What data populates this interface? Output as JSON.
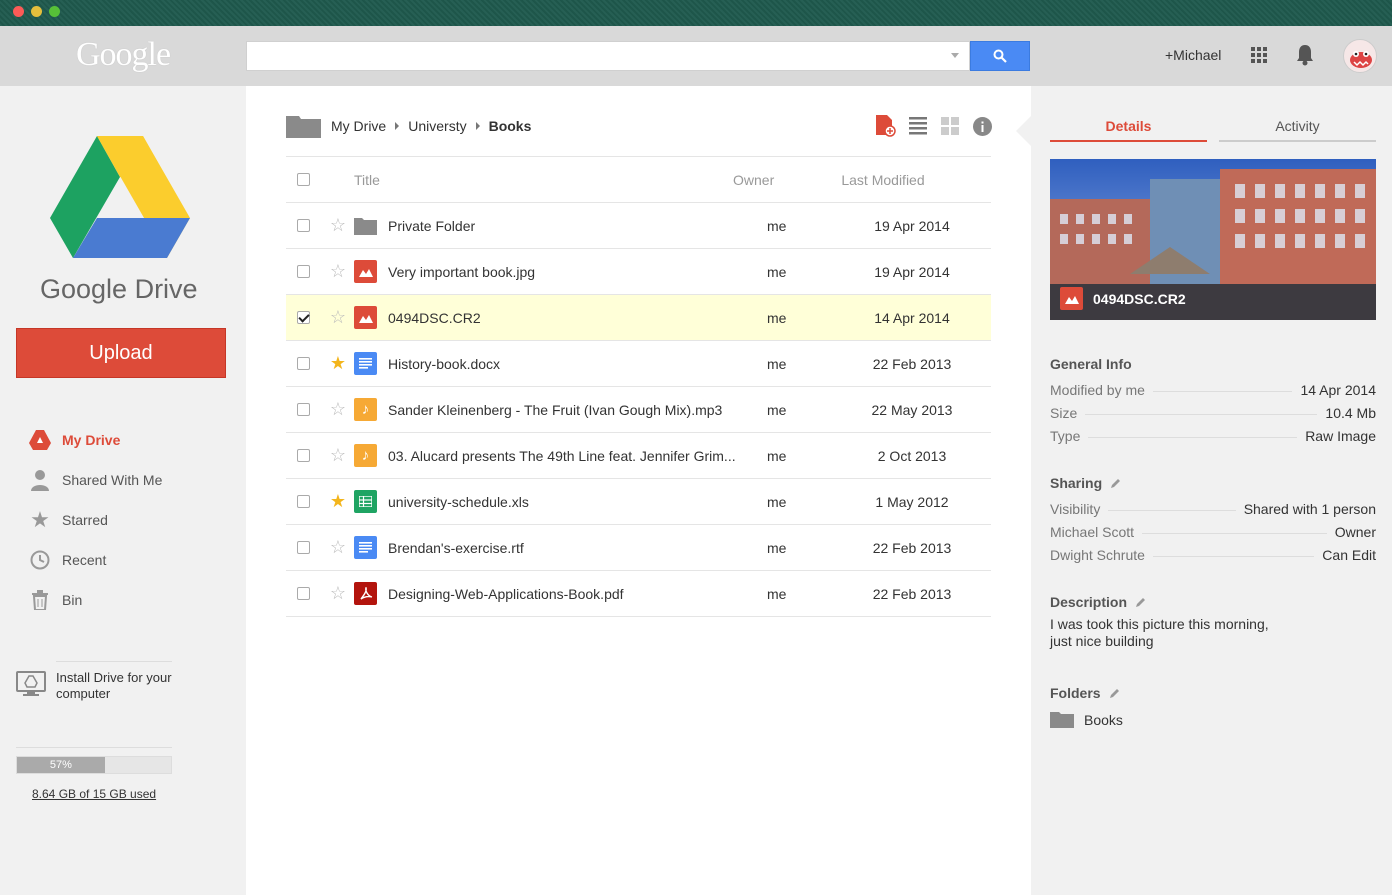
{
  "header": {
    "logo": "Google",
    "search_placeholder": "",
    "user": "+Michael"
  },
  "sidebar": {
    "title": "Google Drive",
    "upload_label": "Upload",
    "nav": [
      {
        "label": "My Drive",
        "icon": "drive-icon",
        "active": true
      },
      {
        "label": "Shared With Me",
        "icon": "person-icon",
        "active": false
      },
      {
        "label": "Starred",
        "icon": "star-icon",
        "active": false
      },
      {
        "label": "Recent",
        "icon": "clock-icon",
        "active": false
      },
      {
        "label": "Bin",
        "icon": "trash-icon",
        "active": false
      }
    ],
    "install_text_1": "Install Drive for your",
    "install_text_2": "computer",
    "storage_percent_label": "57%",
    "storage_percent": 57,
    "storage_used_text": "8.64 GB of 15 GB used"
  },
  "breadcrumb": {
    "items": [
      "My Drive",
      "Universty",
      "Books"
    ]
  },
  "table": {
    "headers": {
      "title": "Title",
      "owner": "Owner",
      "modified": "Last Modified"
    },
    "rows": [
      {
        "title": "Private Folder",
        "owner": "me",
        "modified": "19 Apr 2014",
        "type": "folder",
        "starred": false,
        "checked": false
      },
      {
        "title": "Very important book.jpg",
        "owner": "me",
        "modified": "19 Apr 2014",
        "type": "image",
        "starred": false,
        "checked": false
      },
      {
        "title": "0494DSC.CR2",
        "owner": "me",
        "modified": "14 Apr 2014",
        "type": "image",
        "starred": false,
        "checked": true
      },
      {
        "title": "History-book.docx",
        "owner": "me",
        "modified": "22 Feb 2013",
        "type": "doc",
        "starred": true,
        "checked": false
      },
      {
        "title": "Sander Kleinenberg - The Fruit (Ivan Gough Mix).mp3",
        "owner": "me",
        "modified": "22 May 2013",
        "type": "audio",
        "starred": false,
        "checked": false
      },
      {
        "title": "03. Alucard presents The 49th Line feat. Jennifer Grim...",
        "owner": "me",
        "modified": "2 Oct 2013",
        "type": "audio",
        "starred": false,
        "checked": false
      },
      {
        "title": "university-schedule.xls",
        "owner": "me",
        "modified": "1 May 2012",
        "type": "sheet",
        "starred": true,
        "checked": false
      },
      {
        "title": "Brendan's-exercise.rtf",
        "owner": "me",
        "modified": "22 Feb 2013",
        "type": "doc",
        "starred": false,
        "checked": false
      },
      {
        "title": "Designing-Web-Applications-Book.pdf",
        "owner": "me",
        "modified": "22 Feb 2013",
        "type": "pdf",
        "starred": false,
        "checked": false
      }
    ]
  },
  "details": {
    "tab_details": "Details",
    "tab_activity": "Activity",
    "preview_caption": "0494DSC.CR2",
    "general_title": "General Info",
    "general": [
      {
        "k": "Modified by me",
        "v": "14 Apr 2014"
      },
      {
        "k": "Size",
        "v": "10.4 Mb"
      },
      {
        "k": "Type",
        "v": "Raw Image"
      }
    ],
    "sharing_title": "Sharing",
    "sharing": [
      {
        "k": "Visibility",
        "v": "Shared with 1 person"
      },
      {
        "k": "Michael Scott",
        "v": "Owner"
      },
      {
        "k": "Dwight Schrute",
        "v": "Can Edit"
      }
    ],
    "description_title": "Description",
    "description_line1": "I was took this picture this morning,",
    "description_line2": "just nice building",
    "folders_title": "Folders",
    "folder_name": "Books"
  },
  "colors": {
    "accent": "#dd4b39",
    "search": "#4a8af4",
    "selected_row": "#ffffd8",
    "star": "#f3b51c"
  }
}
